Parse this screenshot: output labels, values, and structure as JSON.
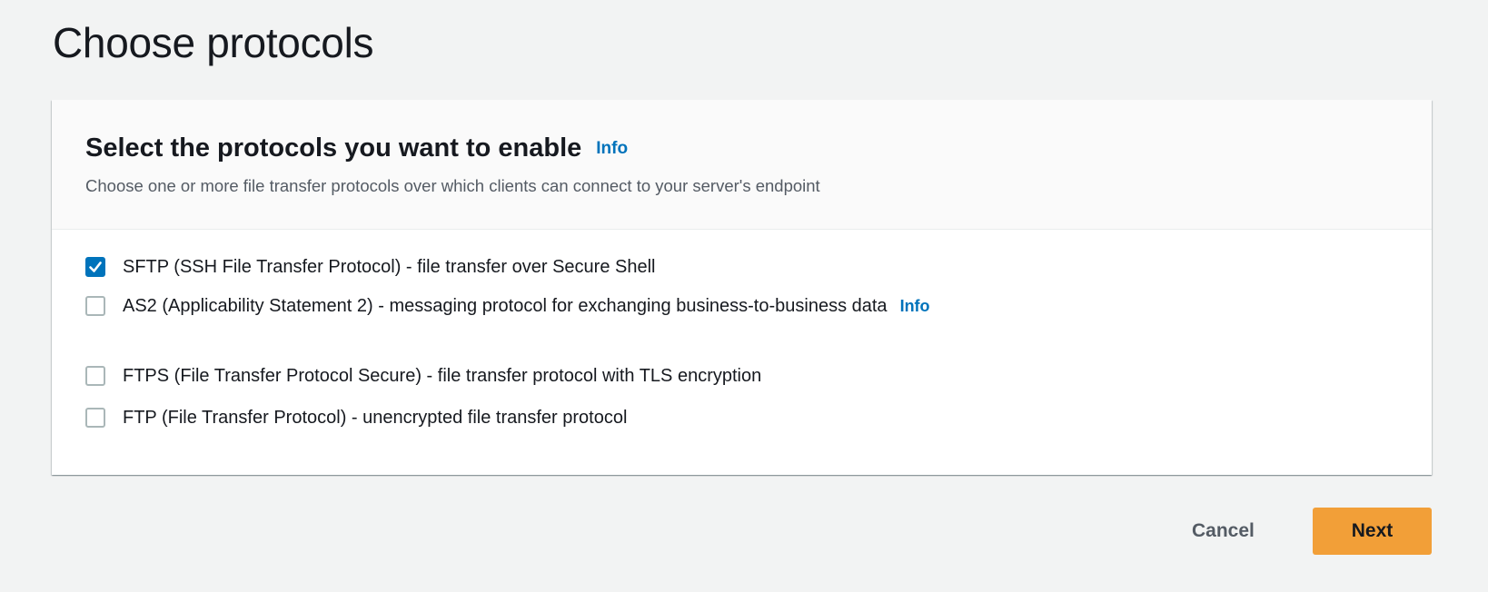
{
  "page": {
    "title": "Choose protocols"
  },
  "panel": {
    "title": "Select the protocols you want to enable",
    "info_label": "Info",
    "description": "Choose one or more file transfer protocols over which clients can connect to your server's endpoint"
  },
  "protocols": [
    {
      "label": "SFTP (SSH File Transfer Protocol) - file transfer over Secure Shell",
      "checked": true
    },
    {
      "label": "AS2 (Applicability Statement 2) - messaging protocol for exchanging business-to-business data",
      "checked": false,
      "info_label": "Info"
    },
    {
      "label": "FTPS (File Transfer Protocol Secure) - file transfer protocol with TLS encryption",
      "checked": false
    },
    {
      "label": "FTP (File Transfer Protocol) - unencrypted file transfer protocol",
      "checked": false
    }
  ],
  "actions": {
    "cancel_label": "Cancel",
    "next_label": "Next"
  },
  "colors": {
    "accent": "#0073bb",
    "primary_button": "#f29f38",
    "background": "#f2f3f3"
  }
}
